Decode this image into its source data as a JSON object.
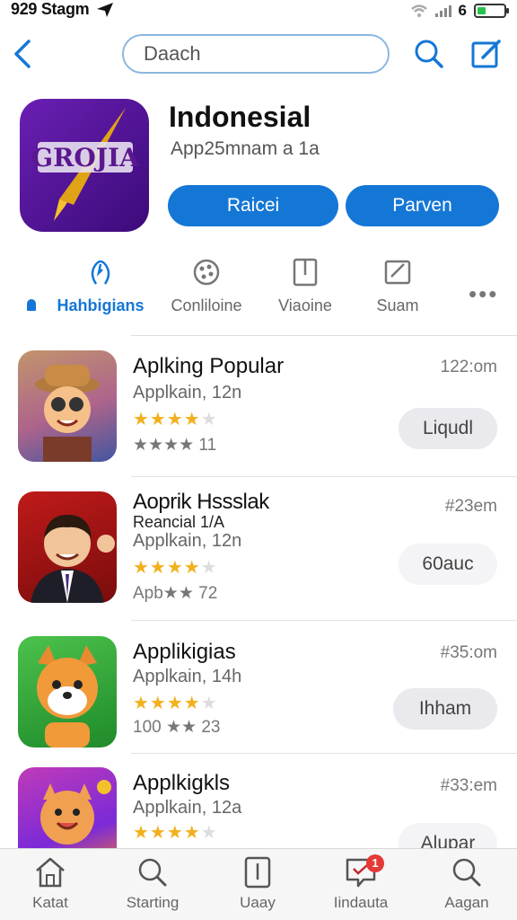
{
  "status_bar": {
    "time": "929 Stagm",
    "carrier_glyph": "6"
  },
  "search": {
    "placeholder": "Daach"
  },
  "app": {
    "name": "Indonesial",
    "subtitle": "App25mnam a 1a",
    "icon_text": "GROJIA",
    "primary_button": "Raicei",
    "secondary_button": "Parven"
  },
  "tabs": [
    {
      "label": "Hahbigians",
      "active": true
    },
    {
      "label": "Conliloine"
    },
    {
      "label": "Viaoine"
    },
    {
      "label": "Suam"
    }
  ],
  "list": [
    {
      "title": "Aplking Popular",
      "category": "Applkain, 12n",
      "time": "122:om",
      "rating_stars": 4,
      "reviews": "★★★★ 11",
      "button": "Liqudl"
    },
    {
      "title": "Aoprik Hssslak",
      "subtitle": "Reancial 1/A",
      "category": "Applkain, 12n",
      "time": "#23em",
      "rating_stars": 4,
      "reviews": "Apb★★ 72",
      "button": "60auc"
    },
    {
      "title": "Applikigias",
      "category": "Applkain, 14h",
      "time": "#35:om",
      "rating_stars": 4,
      "reviews": "100 ★★ 23",
      "button": "Ihham"
    },
    {
      "title": "Applkigkls",
      "category": "Applkain, 12a",
      "time": "#33:em",
      "rating_stars": 4,
      "reviews": "",
      "button": "Alupar"
    }
  ],
  "tabbar": [
    {
      "label": "Katat"
    },
    {
      "label": "Starting"
    },
    {
      "label": "Uaay"
    },
    {
      "label": "Iindauta",
      "badge": "1"
    },
    {
      "label": "Aagan"
    }
  ],
  "colors": {
    "accent": "#1477d6",
    "star": "#f2b01e",
    "badge": "#e53935"
  }
}
